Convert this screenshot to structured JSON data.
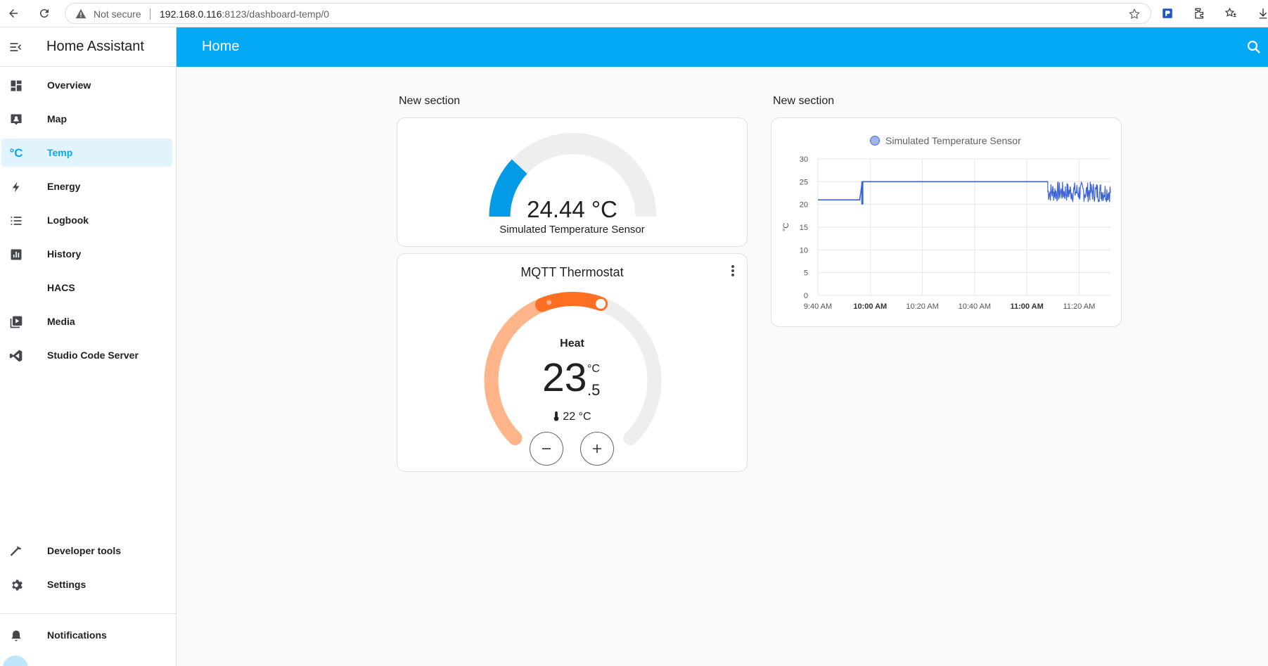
{
  "browser": {
    "security_label": "Not secure",
    "url_host": "192.168.0.116",
    "url_path": ":8123/dashboard-temp/0"
  },
  "sidebar": {
    "app_title": "Home Assistant",
    "items": [
      {
        "label": "Overview",
        "icon": "dashboard-icon"
      },
      {
        "label": "Map",
        "icon": "map-icon"
      },
      {
        "label": "Temp",
        "icon": "celsius-icon",
        "active": true
      },
      {
        "label": "Energy",
        "icon": "lightning-icon"
      },
      {
        "label": "Logbook",
        "icon": "list-icon"
      },
      {
        "label": "History",
        "icon": "chart-icon"
      },
      {
        "label": "HACS",
        "icon": ""
      },
      {
        "label": "Media",
        "icon": "media-icon"
      },
      {
        "label": "Studio Code Server",
        "icon": "vscode-icon"
      }
    ],
    "bottom_items": [
      {
        "label": "Developer tools",
        "icon": "hammer-icon"
      },
      {
        "label": "Settings",
        "icon": "gear-icon"
      }
    ],
    "notifications_label": "Notifications"
  },
  "header": {
    "title": "Home"
  },
  "colors": {
    "primary": "#03a9f4",
    "gauge_fill": "#039be5",
    "heat": "#ff6f22",
    "heat_light": "#ffb48a",
    "series": "#3d63d8"
  },
  "sections": [
    {
      "title": "New section",
      "gauge": {
        "value_text": "24.44 °C",
        "name": "Simulated Temperature Sensor",
        "fraction": 0.24
      },
      "thermostat": {
        "title": "MQTT Thermostat",
        "mode": "Heat",
        "target_int": "23",
        "target_dec": ".5",
        "unit": "°C",
        "current": "22 °C"
      }
    },
    {
      "title": "New section"
    }
  ],
  "chart_data": {
    "type": "line",
    "title": "",
    "ylabel": "°C",
    "xlabel": "",
    "ylim": [
      0,
      30
    ],
    "yticks": [
      "0",
      "5",
      "10",
      "15",
      "20",
      "25",
      "30"
    ],
    "xticks": [
      "9:40 AM",
      "10:00 AM",
      "10:20 AM",
      "10:40 AM",
      "11:00 AM",
      "11:20 AM"
    ],
    "xticks_bold": [
      false,
      true,
      false,
      false,
      true,
      false
    ],
    "grid": true,
    "legend_position": "top-center",
    "series": [
      {
        "name": "Simulated Temperature Sensor",
        "points": [
          [
            "9:40 AM",
            21.0
          ],
          [
            "9:56 AM",
            21.0
          ],
          [
            "9:57 AM",
            25.0
          ],
          [
            "11:08 AM",
            25.0
          ],
          [
            "11:08 AM",
            22.5
          ],
          [
            "11:32 AM",
            22.5
          ]
        ],
        "noise_band": {
          "from": "11:08 AM",
          "to": "11:32 AM",
          "min": 20.5,
          "max": 25.0
        },
        "step_spike": {
          "at": "9:57 AM",
          "min": 20.0,
          "max": 25.0
        }
      }
    ]
  }
}
